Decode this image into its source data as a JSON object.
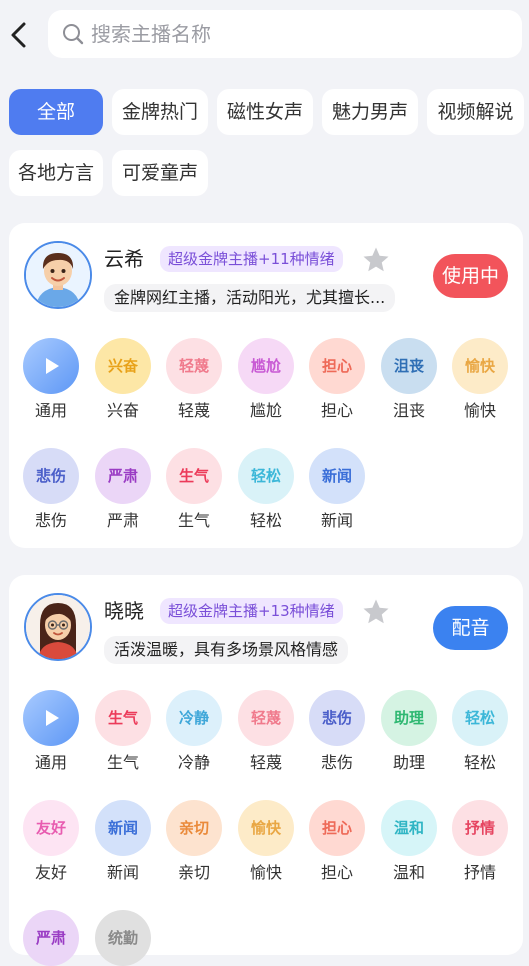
{
  "search": {
    "placeholder": "搜索主播名称"
  },
  "filters": [
    {
      "label": "全部",
      "active": true
    },
    {
      "label": "金牌热门",
      "active": false
    },
    {
      "label": "磁性女声",
      "active": false
    },
    {
      "label": "魅力男声",
      "active": false
    },
    {
      "label": "视频解说",
      "active": false
    },
    {
      "label": "各地方言",
      "active": false
    },
    {
      "label": "可爱童声",
      "active": false
    }
  ],
  "anchors": [
    {
      "name": "云希",
      "badge": "超级金牌主播+11种情绪",
      "description": "金牌网红主播，活动阳光，尤其擅长...",
      "action_label": "使用中",
      "action_color": "#f2545b",
      "emotions": [
        {
          "icon": "play-icon",
          "label": "通用"
        },
        {
          "icon_text": "兴奋",
          "label": "兴奋",
          "bg": "#fde7a6",
          "fg": "#e8a21a"
        },
        {
          "icon_text": "轻蔑",
          "label": "轻蔑",
          "bg": "#fde0e4",
          "fg": "#f07a8c"
        },
        {
          "icon_text": "尴尬",
          "label": "尴尬",
          "bg": "#f6d9f6",
          "fg": "#c85ad4"
        },
        {
          "icon_text": "担心",
          "label": "担心",
          "bg": "#ffd9d2",
          "fg": "#ee6a58"
        },
        {
          "icon_text": "沮丧",
          "label": "沮丧",
          "bg": "#c9def0",
          "fg": "#2f6fb5"
        },
        {
          "icon_text": "愉快",
          "label": "愉快",
          "bg": "#fdebc8",
          "fg": "#e9a744"
        },
        {
          "icon_text": "悲伤",
          "label": "悲伤",
          "bg": "#d7dcf7",
          "fg": "#4a5ec9"
        },
        {
          "icon_text": "严肃",
          "label": "严肃",
          "bg": "#ebd6f7",
          "fg": "#9a3cc4"
        },
        {
          "icon_text": "生气",
          "label": "生气",
          "bg": "#fde0e4",
          "fg": "#ec3b5a"
        },
        {
          "icon_text": "轻松",
          "label": "轻松",
          "bg": "#d9f2f8",
          "fg": "#3cb7d8"
        },
        {
          "icon_text": "新闻",
          "label": "新闻",
          "bg": "#d3e1fa",
          "fg": "#3b6fd8"
        }
      ]
    },
    {
      "name": "晓晓",
      "badge": "超级金牌主播+13种情绪",
      "description": "活泼温暖，具有多场景风格情感",
      "action_label": "配音",
      "action_color": "#3b82f0",
      "emotions": [
        {
          "icon": "play-icon",
          "label": "通用"
        },
        {
          "icon_text": "生气",
          "label": "生气",
          "bg": "#fde0e4",
          "fg": "#ec3b5a"
        },
        {
          "icon_text": "冷静",
          "label": "冷静",
          "bg": "#dcf0fb",
          "fg": "#3fa7d9"
        },
        {
          "icon_text": "轻蔑",
          "label": "轻蔑",
          "bg": "#fde0e4",
          "fg": "#f07a8c"
        },
        {
          "icon_text": "悲伤",
          "label": "悲伤",
          "bg": "#d7dcf7",
          "fg": "#4a5ec9"
        },
        {
          "icon_text": "助理",
          "label": "助理",
          "bg": "#d5f3e3",
          "fg": "#2fb872"
        },
        {
          "icon_text": "轻松",
          "label": "轻松",
          "bg": "#d9f2f8",
          "fg": "#3cb7d8"
        },
        {
          "icon_text": "友好",
          "label": "友好",
          "bg": "#fde4f3",
          "fg": "#e85cb0"
        },
        {
          "icon_text": "新闻",
          "label": "新闻",
          "bg": "#d3e1fa",
          "fg": "#3b6fd8"
        },
        {
          "icon_text": "亲切",
          "label": "亲切",
          "bg": "#fde3cf",
          "fg": "#ea8a3a"
        },
        {
          "icon_text": "愉快",
          "label": "愉快",
          "bg": "#fdebc8",
          "fg": "#e9a744"
        },
        {
          "icon_text": "担心",
          "label": "担心",
          "bg": "#ffd9d2",
          "fg": "#ee6a58"
        },
        {
          "icon_text": "温和",
          "label": "温和",
          "bg": "#d6f5f8",
          "fg": "#2fb5c4"
        },
        {
          "icon_text": "抒情",
          "label": "抒情",
          "bg": "#fde0e4",
          "fg": "#e64561"
        },
        {
          "icon_text": "严肃",
          "label": "",
          "bg": "#ebd6f7",
          "fg": "#9a3cc4"
        },
        {
          "icon_text": "统勤",
          "label": "",
          "bg": "#e0e0e0",
          "fg": "#8a8a8a"
        }
      ]
    }
  ]
}
